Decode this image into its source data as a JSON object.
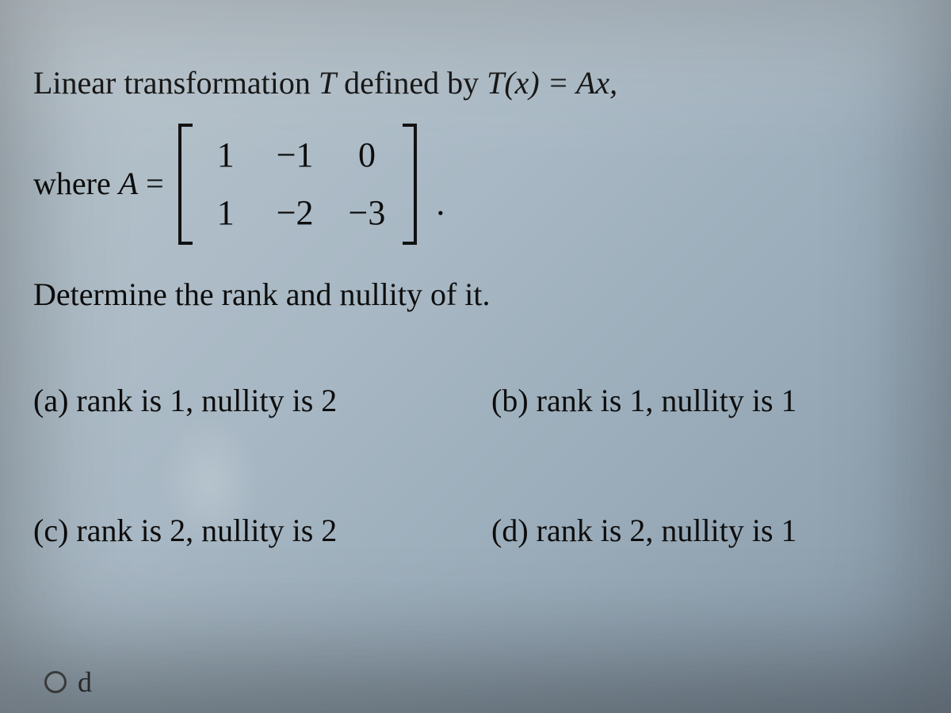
{
  "line1_pre": "Linear transformation ",
  "line1_T": "T",
  "line1_mid": " defined by ",
  "line1_eq": "T(x) = Ax,",
  "where_label_pre": "where ",
  "where_A": "A",
  "where_eq": " =",
  "matrix": {
    "r1c1": "1",
    "r1c2": "−1",
    "r1c3": "0",
    "r2c1": "1",
    "r2c2": "−2",
    "r2c3": "−3"
  },
  "period": ".",
  "determine": "Determine the rank and nullity of it.",
  "options": {
    "a": "(a) rank is 1, nullity is 2",
    "b": "(b)  rank is 1, nullity is 1",
    "c": "(c)  rank is 2, nullity is 2",
    "d": "(d)  rank is 2, nullity is 1"
  },
  "radio_label": "d"
}
